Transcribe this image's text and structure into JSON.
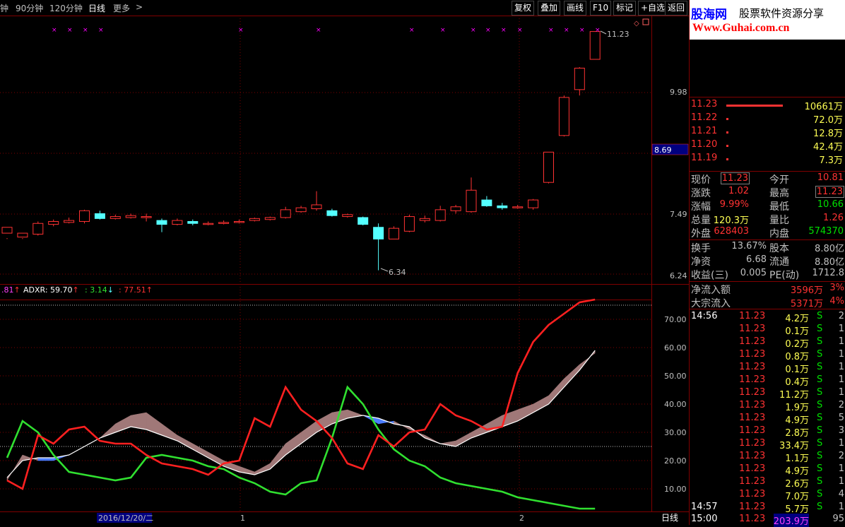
{
  "periods": [
    {
      "label": "钟",
      "active": false
    },
    {
      "label": "90分钟",
      "active": false
    },
    {
      "label": "120分钟",
      "active": false
    },
    {
      "label": "日线",
      "active": true
    },
    {
      "label": "更多",
      "active": false
    }
  ],
  "more_arrow": ">",
  "toolbar": [
    "复权",
    "叠加",
    "画线",
    "F10",
    "标记",
    "+自选",
    "返回"
  ],
  "price_axis": {
    "labels": [
      "9.98",
      "7.49",
      "6.24"
    ],
    "marker": "8.69",
    "high_label": "11.23",
    "low_label": "6.34"
  },
  "indicator": {
    "prefix": ".81",
    "prefix_arrow": "↑",
    "name": "ADXR: 59.70",
    "name_arrow": "↑",
    "v2": ": 3.14",
    "v2_arrow": "↓",
    "v3": ": 77.51",
    "v3_arrow": "↑",
    "axis": [
      "70.00",
      "60.00",
      "50.00",
      "40.00",
      "30.00",
      "20.00",
      "10.00"
    ]
  },
  "date_axis": {
    "first": "2016/12/20/二",
    "m1": "1",
    "m2": "2",
    "period": "日线"
  },
  "logo": {
    "cn": "股海网",
    "slogan": "股票软件资源分享",
    "url": "Www.Guhai.com.cn"
  },
  "orderbook": [
    {
      "price": "11.23",
      "vol": "10661万"
    },
    {
      "price": "11.22",
      "vol": "72.0万"
    },
    {
      "price": "11.21",
      "vol": "12.8万"
    },
    {
      "price": "11.20",
      "vol": "42.4万"
    },
    {
      "price": "11.19",
      "vol": "7.3万"
    }
  ],
  "quote": [
    {
      "l": "现价",
      "v": "11.23",
      "r": "今开",
      "rv": "10.81"
    },
    {
      "l": "涨跌",
      "v": "1.02",
      "r": "最高",
      "rv": "11.23"
    },
    {
      "l": "涨幅",
      "v": "9.99%",
      "r": "最低",
      "rv": "10.66"
    },
    {
      "l": "总量",
      "v": "120.3万",
      "r": "量比",
      "rv": "1.26"
    },
    {
      "l": "外盘",
      "v": "628403",
      "r": "内盘",
      "rv": "574370"
    }
  ],
  "fund": [
    {
      "l": "换手",
      "v": "13.67%",
      "r": "股本",
      "rv": "8.80亿"
    },
    {
      "l": "净资",
      "v": "6.68",
      "r": "流通",
      "rv": "8.80亿"
    },
    {
      "l": "收益(三)",
      "v": "0.005",
      "r": "PE(动)",
      "rv": "1712.8"
    }
  ],
  "flow": [
    {
      "l": "净流入额",
      "v": "3596万",
      "p": "3%"
    },
    {
      "l": "大宗流入",
      "v": "5371万",
      "p": "4%"
    }
  ],
  "ticks": [
    {
      "t": "14:56",
      "p": "11.23",
      "v": "4.2万",
      "s": "S",
      "n": "2"
    },
    {
      "t": "",
      "p": "11.23",
      "v": "0.1万",
      "s": "S",
      "n": "1"
    },
    {
      "t": "",
      "p": "11.23",
      "v": "0.2万",
      "s": "S",
      "n": "1"
    },
    {
      "t": "",
      "p": "11.23",
      "v": "0.8万",
      "s": "S",
      "n": "1"
    },
    {
      "t": "",
      "p": "11.23",
      "v": "0.1万",
      "s": "S",
      "n": "1"
    },
    {
      "t": "",
      "p": "11.23",
      "v": "0.4万",
      "s": "S",
      "n": "1"
    },
    {
      "t": "",
      "p": "11.23",
      "v": "11.2万",
      "s": "S",
      "n": "1"
    },
    {
      "t": "",
      "p": "11.23",
      "v": "1.9万",
      "s": "S",
      "n": "2"
    },
    {
      "t": "",
      "p": "11.23",
      "v": "4.9万",
      "s": "S",
      "n": "5"
    },
    {
      "t": "",
      "p": "11.23",
      "v": "2.8万",
      "s": "S",
      "n": "3"
    },
    {
      "t": "",
      "p": "11.23",
      "v": "33.4万",
      "s": "S",
      "n": "1"
    },
    {
      "t": "",
      "p": "11.23",
      "v": "1.1万",
      "s": "S",
      "n": "2"
    },
    {
      "t": "",
      "p": "11.23",
      "v": "4.9万",
      "s": "S",
      "n": "1"
    },
    {
      "t": "",
      "p": "11.23",
      "v": "2.6万",
      "s": "S",
      "n": "1"
    },
    {
      "t": "",
      "p": "11.23",
      "v": "7.0万",
      "s": "S",
      "n": "4"
    },
    {
      "t": "14:57",
      "p": "11.23",
      "v": "5.7万",
      "s": "S",
      "n": "1"
    },
    {
      "t": "15:00",
      "p": "11.23",
      "v": "203.9万",
      "s": "",
      "n": "95"
    }
  ],
  "colors": {
    "up": "#ff3232",
    "down": "#54ffff",
    "grid": "#800000",
    "pdi": "#ff2020",
    "mdi": "#30e030",
    "adxr": "#ffffff",
    "fill_up": "#a07878",
    "fill_dn": "#4a7cff",
    "marker": "#ff00ff",
    "yellow": "#ffff54",
    "green": "#00e000",
    "label": "#c0c0c0"
  }
}
